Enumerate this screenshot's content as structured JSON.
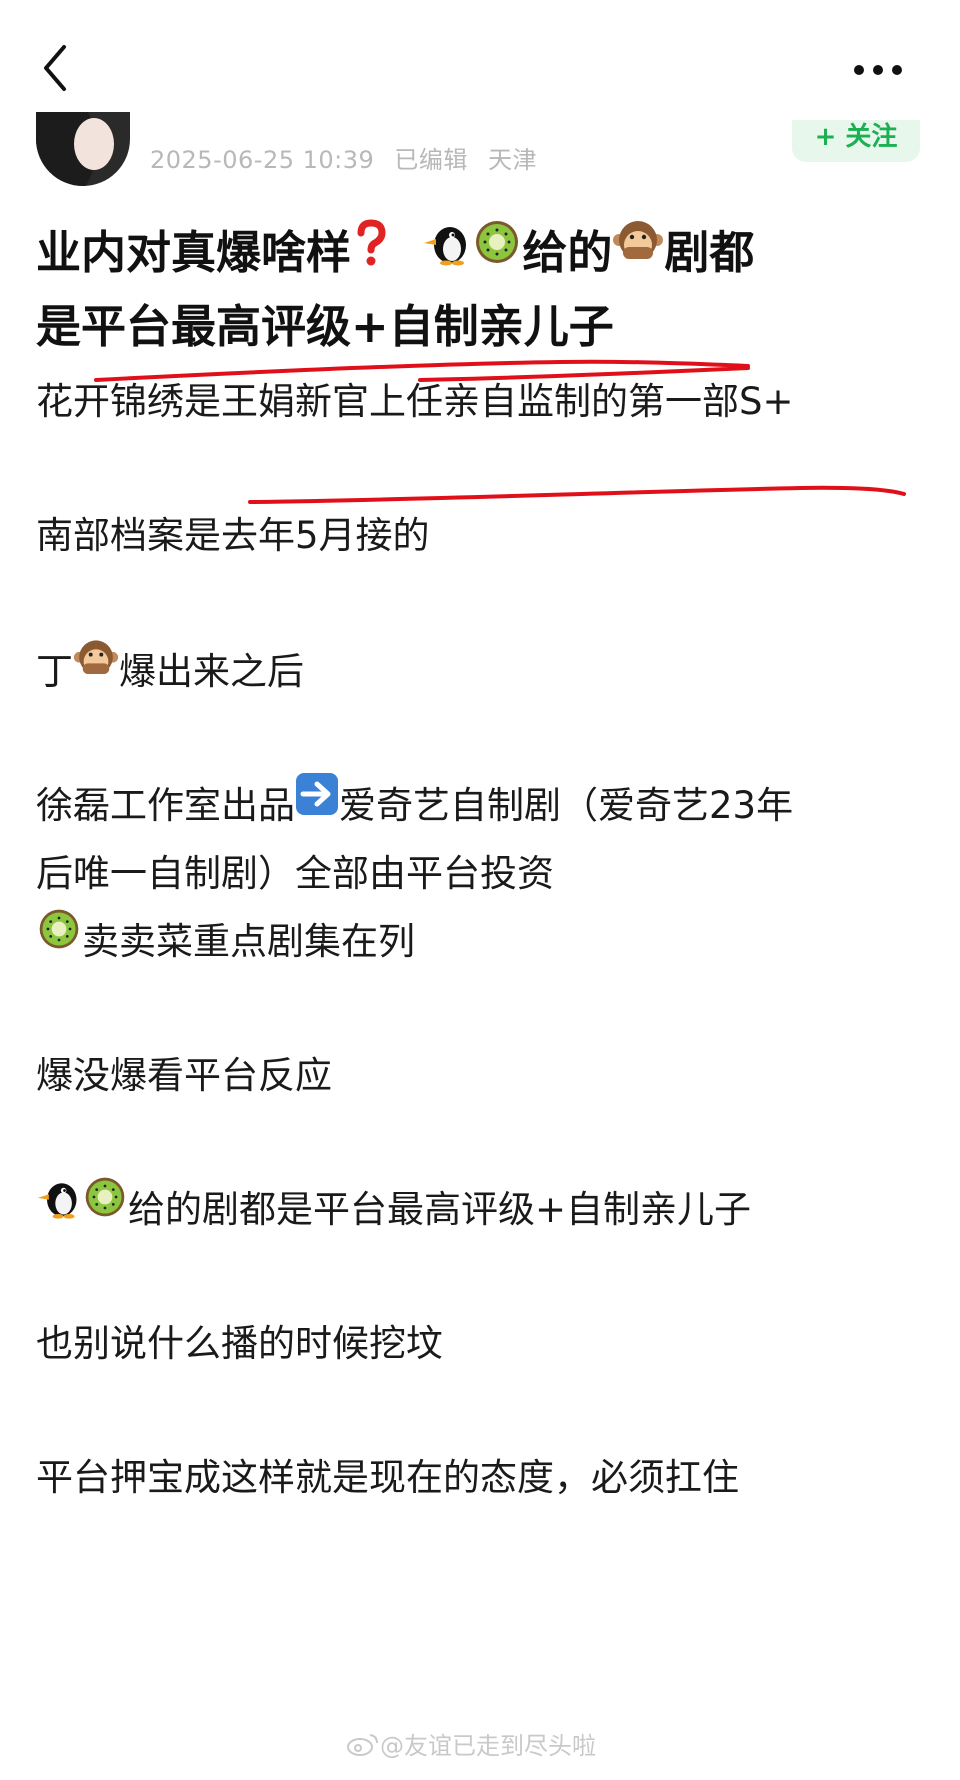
{
  "nav": {
    "back_icon": "chevron-left-icon",
    "more_icon": "more-dots-icon"
  },
  "meta": {
    "timestamp": "2025-06-25 10:39",
    "edited": "已编辑",
    "location": "天津",
    "follow_label": "+ 关注"
  },
  "post": {
    "title_part1": "业内对真爆啥样",
    "title_part2": "给的",
    "title_part3": "剧都",
    "title_line2": "是平台最高评级+自制亲儿子",
    "p1": "花开锦绣是王娟新官上任亲自监制的第一部S+",
    "p2": "南部档案是去年5月接的",
    "p3_a": "丁",
    "p3_b": "爆出来之后",
    "p4_a": "徐磊工作室出品",
    "p4_b": "爱奇艺自制剧（爱奇艺23年",
    "p4_c": "后唯一自制剧）全部由平台投资",
    "p5": "卖卖菜重点剧集在列",
    "p6": "爆没爆看平台反应",
    "p7": "给的剧都是平台最高评级+自制亲儿子",
    "p8": "也别说什么播的时候挖坟",
    "p9": "平台押宝成这样就是现在的态度，必须扛住"
  },
  "watermark": {
    "text": "@友谊已走到尽头啦"
  },
  "colors": {
    "underline": "#e0101a",
    "follow_text": "#1bb052",
    "follow_bg": "#e7f7ec",
    "meta_text": "#b8b8b8"
  },
  "icons": {
    "question": "red-question-icon",
    "penguin": "penguin-icon",
    "kiwi": "kiwi-icon",
    "monkey": "see-no-evil-monkey-icon",
    "arrow": "right-arrow-icon"
  }
}
